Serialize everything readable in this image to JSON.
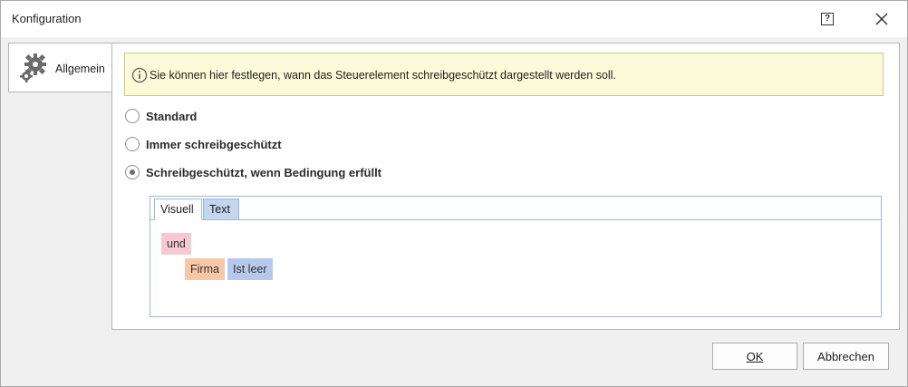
{
  "window": {
    "title": "Konfiguration"
  },
  "titlebar": {
    "help_icon": "help-icon",
    "close_icon": "close-icon"
  },
  "side_tab": {
    "label": "Allgemein",
    "icon": "gear-icon"
  },
  "info": {
    "text": "Sie können hier festlegen, wann das Steuerelement schreibgeschützt dargestellt werden soll.",
    "icon": "info-icon"
  },
  "options": [
    {
      "label": "Standard",
      "checked": false
    },
    {
      "label": "Immer schreibgeschützt",
      "checked": false
    },
    {
      "label": "Schreibgeschützt, wenn Bedingung erfüllt",
      "checked": true
    }
  ],
  "condition": {
    "tabs": [
      {
        "label": "Visuell",
        "active": true
      },
      {
        "label": "Text",
        "active": false
      }
    ],
    "operator": "und",
    "field": "Firma",
    "comparison": "Ist leer"
  },
  "buttons": {
    "ok": "OK",
    "cancel": "Abbrechen"
  },
  "colors": {
    "info_bg": "#fbfbd9",
    "chip_operator": "#f5c8d2",
    "chip_field": "#f6c8a8",
    "chip_comparison": "#b8c8ec",
    "tab_inactive": "#c4d5f0"
  }
}
